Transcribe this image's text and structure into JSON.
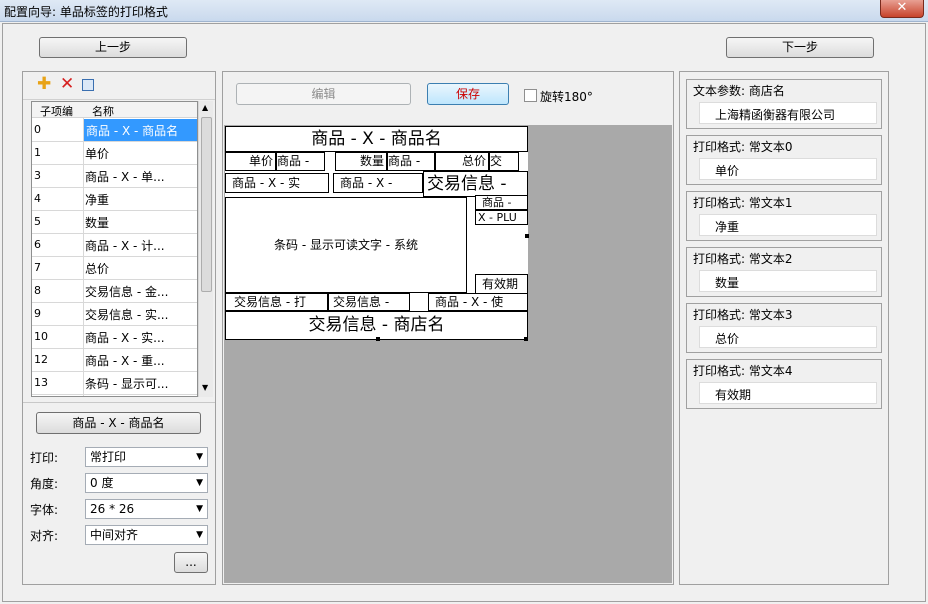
{
  "window": {
    "title": "配置向导: 单品标签的打印格式",
    "close_label": "✕"
  },
  "nav": {
    "prev_label": "上一步",
    "next_label": "下一步"
  },
  "toolbar": {
    "edit_label": "编辑",
    "save_label": "保存",
    "rotate_label": "旋转180°"
  },
  "list": {
    "headers": [
      "子项编",
      "名称"
    ],
    "rows": [
      {
        "id": "0",
        "name": "商品 - X - 商品名"
      },
      {
        "id": "1",
        "name": "单价"
      },
      {
        "id": "3",
        "name": "商品 - X - 单..."
      },
      {
        "id": "4",
        "name": "净重"
      },
      {
        "id": "5",
        "name": "数量"
      },
      {
        "id": "6",
        "name": "商品 - X - 计..."
      },
      {
        "id": "7",
        "name": "总价"
      },
      {
        "id": "8",
        "name": "交易信息 - 金..."
      },
      {
        "id": "9",
        "name": "交易信息 - 实..."
      },
      {
        "id": "10",
        "name": "商品 - X - 实..."
      },
      {
        "id": "12",
        "name": "商品 - X - 重..."
      },
      {
        "id": "13",
        "name": "条码 - 显示可..."
      }
    ]
  },
  "props": {
    "field_button": "商品 - X - 商品名",
    "print_label": "打印:",
    "print_value": "常打印",
    "angle_label": "角度:",
    "angle_value": "0 度",
    "font_label": "字体:",
    "font_value": "26 * 26",
    "align_label": "对齐:",
    "align_value": "中间对齐",
    "more_label": "..."
  },
  "preview": {
    "title": "商品 - X - 商品名",
    "r2": [
      "单价",
      "商品 -",
      "数量",
      "商品 -",
      "总价",
      "交"
    ],
    "r3": [
      "商品 - X - 实",
      "商品 - X -",
      "交易信息 -"
    ],
    "barcode": "条码 - 显示可读文字 - 系统",
    "side1": "商品 -",
    "side2": "X - PLU",
    "expiry": "有效期",
    "r5": [
      "交易信息 - 打",
      "交易信息 -",
      "商品 - X - 使"
    ],
    "footer": "交易信息 - 商店名"
  },
  "params": [
    {
      "title": "文本参数: 商店名",
      "value": "上海精函衡器有限公司"
    },
    {
      "title": "打印格式: 常文本0",
      "value": "单价"
    },
    {
      "title": "打印格式: 常文本1",
      "value": "净重"
    },
    {
      "title": "打印格式: 常文本2",
      "value": "数量"
    },
    {
      "title": "打印格式: 常文本3",
      "value": "总价"
    },
    {
      "title": "打印格式: 常文本4",
      "value": "有效期"
    }
  ]
}
